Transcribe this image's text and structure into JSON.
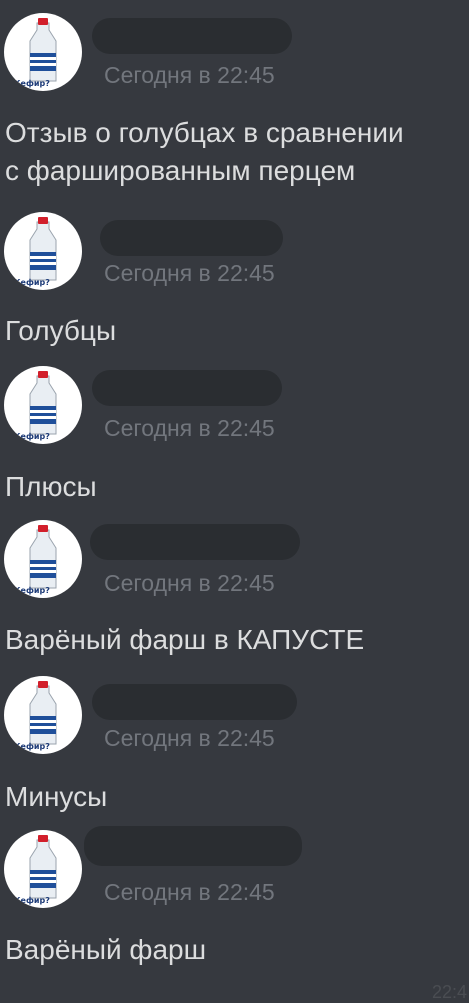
{
  "messages": [
    {
      "timestamp": "Сегодня в 22:45",
      "text": "Отзыв о голубцах в сравнении\nс фаршированным перцем"
    },
    {
      "timestamp": "Сегодня в 22:45",
      "text": "Голубцы"
    },
    {
      "timestamp": "Сегодня в 22:45",
      "text": "Плюсы"
    },
    {
      "timestamp": "Сегодня в 22:45",
      "text": "Варёный фарш в КАПУСТЕ"
    },
    {
      "timestamp": "Сегодня в 22:45",
      "text": "Минусы"
    },
    {
      "timestamp": "Сегодня в 22:45",
      "text": "Варёный фарш"
    }
  ],
  "avatar_label": "Кефир?",
  "partial_time": "22:4",
  "colors": {
    "background": "#36393f",
    "text": "#dcddde",
    "timestamp": "#72767d",
    "redacted_name": "#2a2d31"
  }
}
